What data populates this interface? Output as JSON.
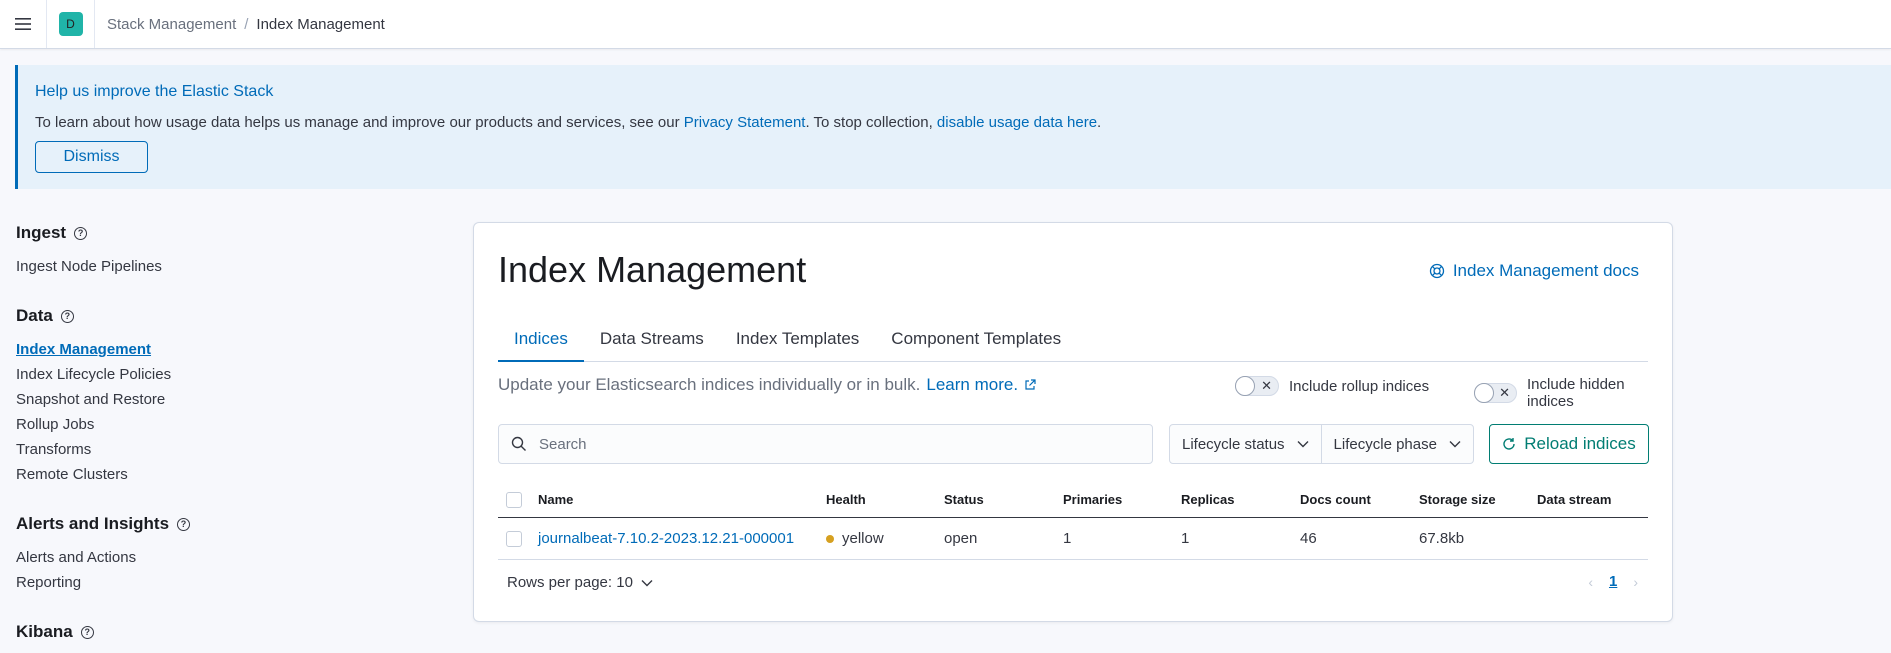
{
  "header": {
    "space_initial": "D",
    "breadcrumbs": [
      "Stack Management",
      "Index Management"
    ]
  },
  "banner": {
    "title": "Help us improve the Elastic Stack",
    "text_before": "To learn about how usage data helps us manage and improve our products and services, see our ",
    "privacy_link": "Privacy Statement",
    "text_middle": ". To stop collection, ",
    "disable_link": "disable usage data here",
    "text_end": ".",
    "dismiss_label": "Dismiss"
  },
  "sidenav": {
    "groups": [
      {
        "title": "Ingest",
        "items": [
          "Ingest Node Pipelines"
        ]
      },
      {
        "title": "Data",
        "items": [
          "Index Management",
          "Index Lifecycle Policies",
          "Snapshot and Restore",
          "Rollup Jobs",
          "Transforms",
          "Remote Clusters"
        ]
      },
      {
        "title": "Alerts and Insights",
        "items": [
          "Alerts and Actions",
          "Reporting"
        ]
      },
      {
        "title": "Kibana",
        "items": []
      }
    ],
    "active_item": "Index Management"
  },
  "main": {
    "title": "Index Management",
    "docs_link": "Index Management docs",
    "tabs": [
      "Indices",
      "Data Streams",
      "Index Templates",
      "Component Templates"
    ],
    "active_tab": "Indices",
    "description": "Update your Elasticsearch indices individually or in bulk.",
    "learn_more": "Learn more.",
    "toggle_rollup": "Include rollup indices",
    "toggle_hidden": "Include hidden indices",
    "search_placeholder": "Search",
    "filter_lifecycle_status": "Lifecycle status",
    "filter_lifecycle_phase": "Lifecycle phase",
    "reload_label": "Reload indices",
    "table": {
      "columns": [
        "Name",
        "Health",
        "Status",
        "Primaries",
        "Replicas",
        "Docs count",
        "Storage size",
        "Data stream"
      ],
      "rows": [
        {
          "name": "journalbeat-7.10.2-2023.12.21-000001",
          "health": "yellow",
          "status": "open",
          "primaries": "1",
          "replicas": "1",
          "docs_count": "46",
          "storage_size": "67.8kb",
          "data_stream": ""
        }
      ]
    },
    "rows_per_page": "Rows per page: 10",
    "current_page": "1"
  },
  "colors": {
    "primary": "#006bb8",
    "success": "#017d73",
    "health_yellow": "#d6a020",
    "space_avatar": "#20b4a8"
  }
}
